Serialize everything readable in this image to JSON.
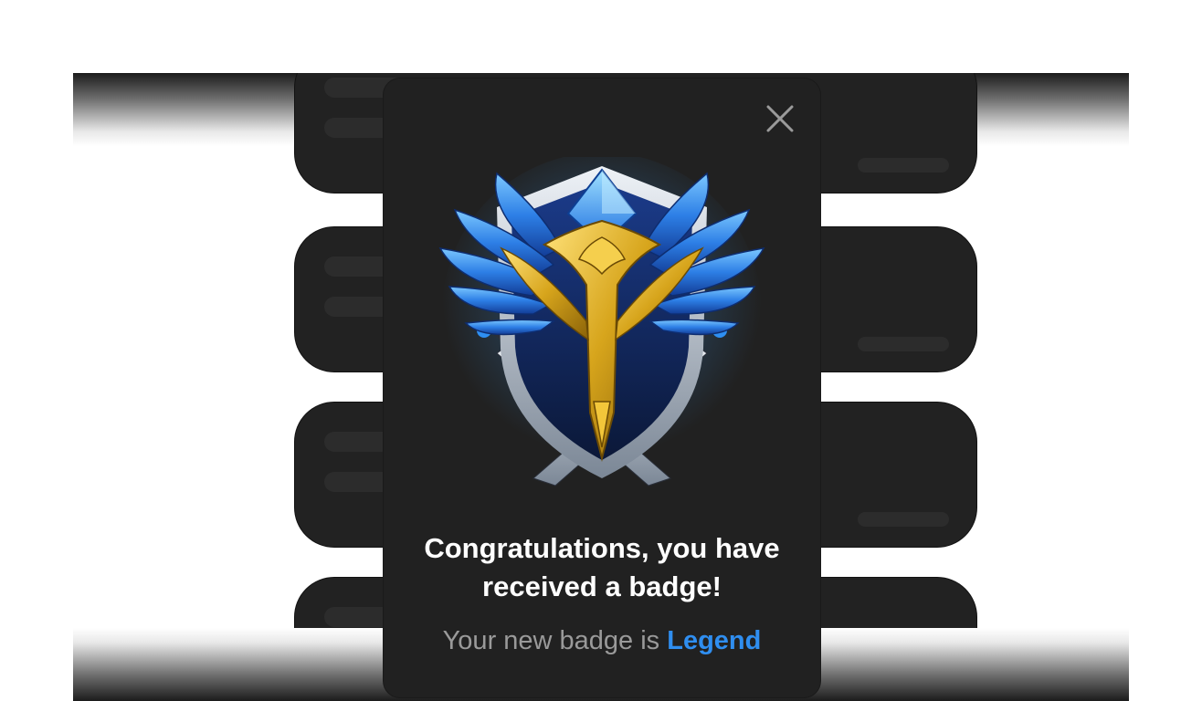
{
  "modal": {
    "title": "Congratulations, you have received a badge!",
    "subtitle_prefix": "Your new badge is",
    "badge_name": "Legend",
    "close_icon": "close-icon",
    "badge_icon": "legend-badge-emblem"
  },
  "colors": {
    "modal_background": "#212121",
    "accent": "#2f8ef0",
    "title_text": "#ffffff",
    "subtitle_text": "#9a9a9a",
    "card_background": "#222222"
  }
}
